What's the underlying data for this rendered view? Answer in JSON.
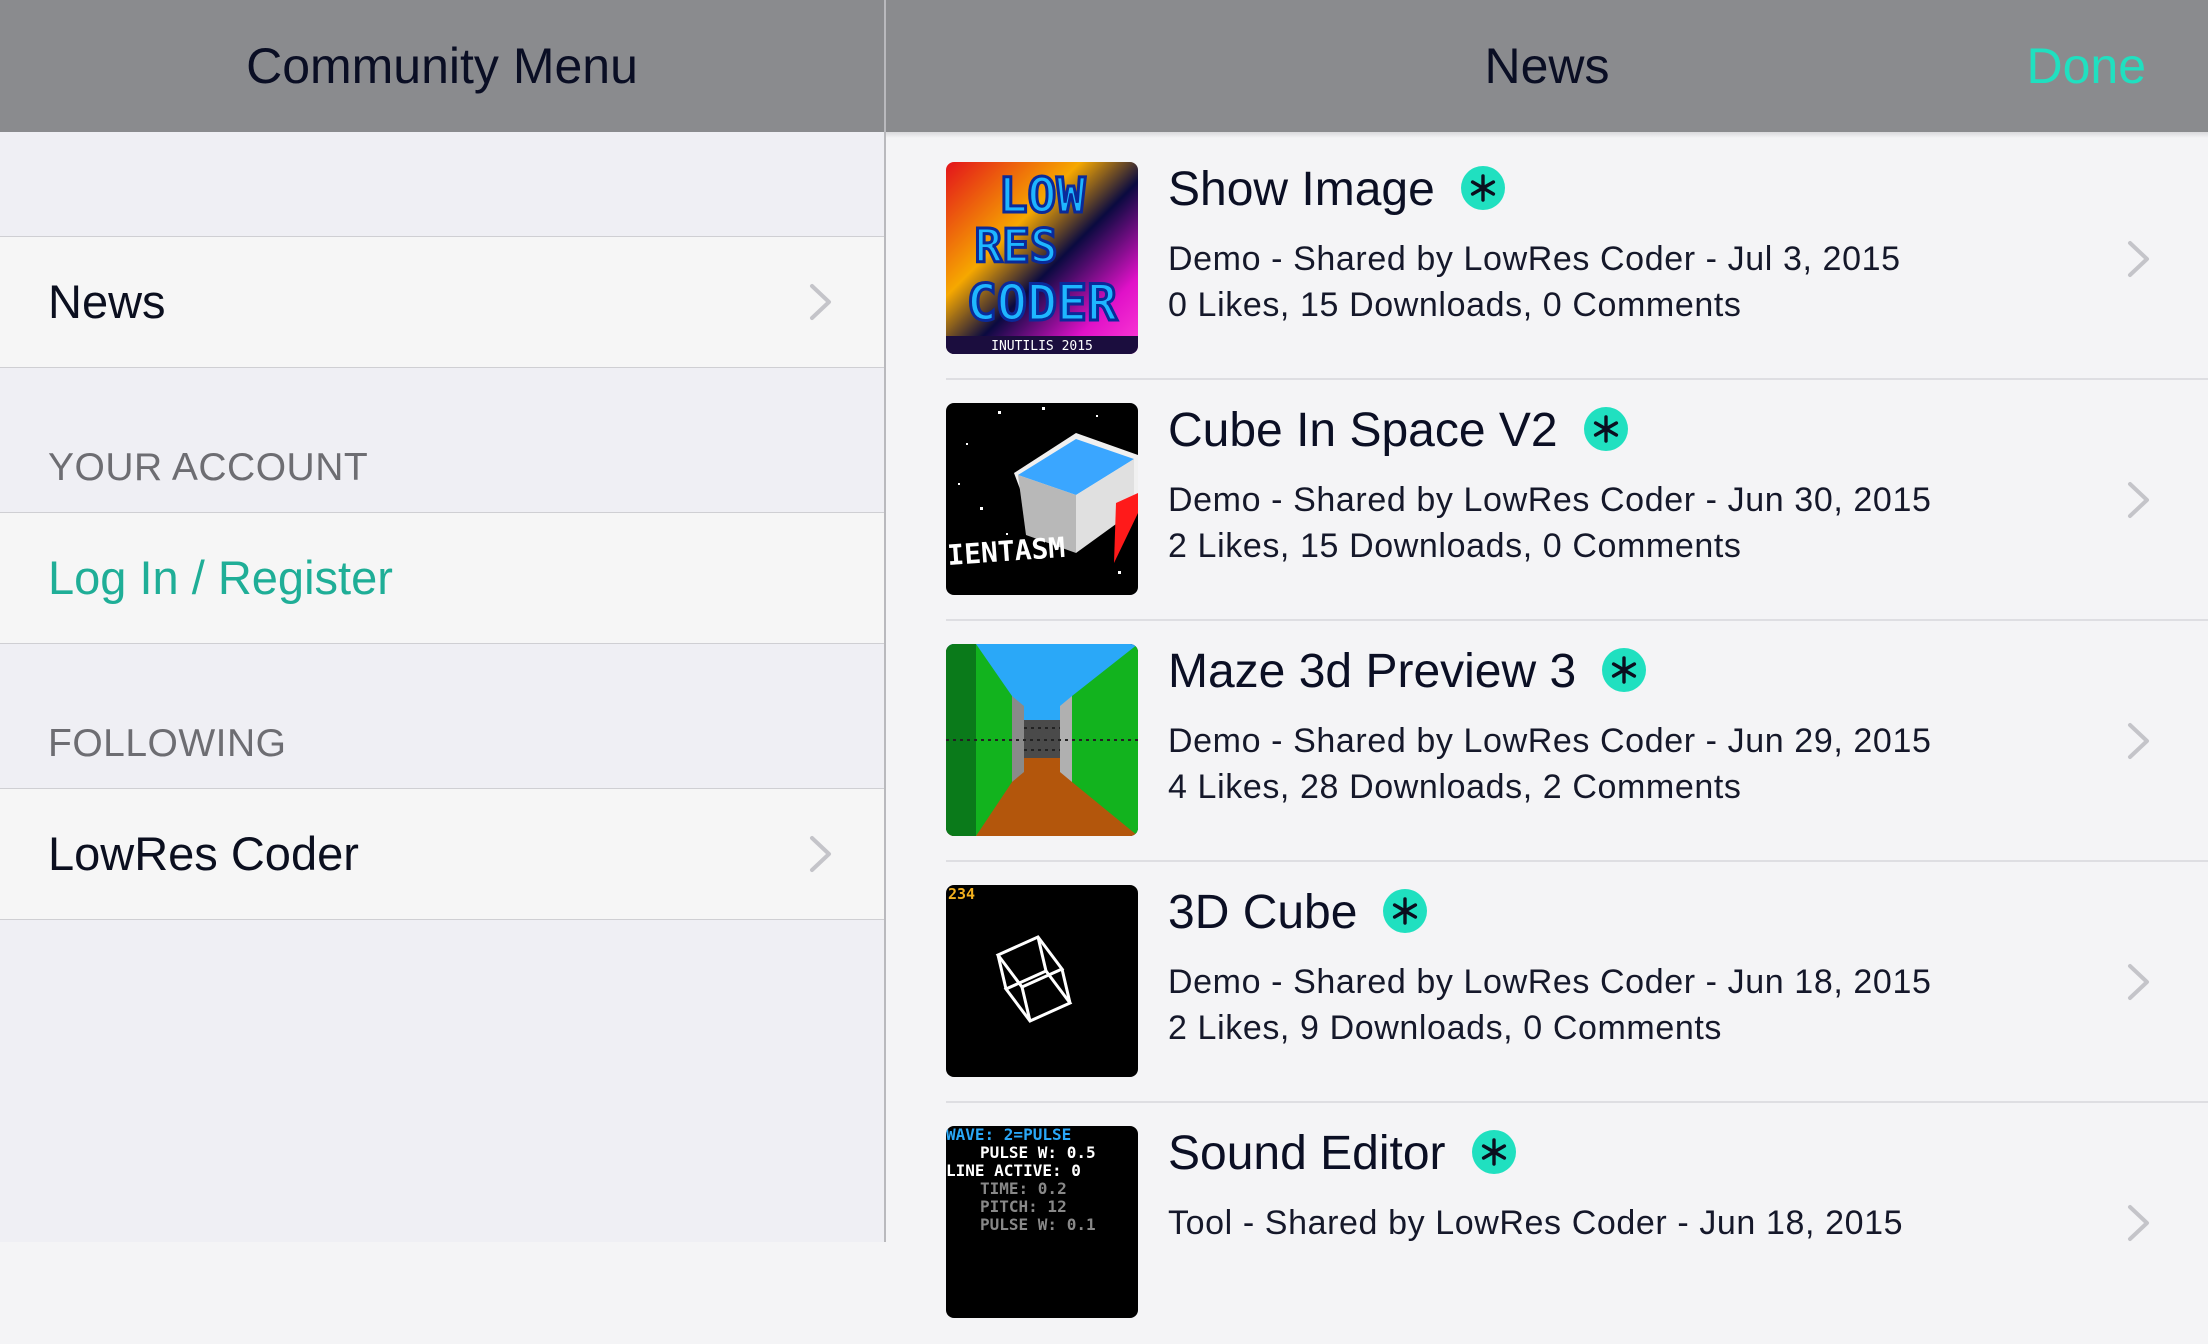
{
  "menu": {
    "title": "Community Menu",
    "news_label": "News",
    "account_header": "YOUR ACCOUNT",
    "login_label": "Log In / Register",
    "following_header": "FOLLOWING",
    "following_items": [
      "LowRes Coder"
    ]
  },
  "news": {
    "title": "News",
    "done_label": "Done",
    "accent_color": "#20e0c0",
    "items": [
      {
        "title": "Show Image",
        "subtitle": "Demo - Shared by LowRes Coder - Jul 3, 2015",
        "stats": "0 Likes, 15 Downloads, 0 Comments",
        "thumb_icon": "lowres-coder-logo-thumbnail"
      },
      {
        "title": "Cube In Space V2",
        "subtitle": "Demo - Shared by LowRes Coder - Jun 30, 2015",
        "stats": "2 Likes, 15 Downloads, 0 Comments",
        "thumb_icon": "cube-in-space-thumbnail"
      },
      {
        "title": "Maze 3d Preview 3",
        "subtitle": "Demo - Shared by LowRes Coder - Jun 29, 2015",
        "stats": "4 Likes, 28 Downloads, 2 Comments",
        "thumb_icon": "maze-corridor-thumbnail"
      },
      {
        "title": "3D Cube",
        "subtitle": "Demo - Shared by LowRes Coder - Jun 18, 2015",
        "stats": "2 Likes, 9 Downloads, 0 Comments",
        "thumb_icon": "wireframe-cube-thumbnail"
      },
      {
        "title": "Sound Editor",
        "subtitle": "Tool - Shared by LowRes Coder - Jun 18, 2015",
        "stats": "",
        "thumb_icon": "sound-editor-thumbnail"
      }
    ],
    "thumb_texts": {
      "logo_line1": "LOW",
      "logo_line2": "RES",
      "logo_line3": "CODER",
      "logo_footer": "INUTILIS 2015",
      "cube_caption": "IENTASM",
      "cube_counter": "234",
      "sound_lines": [
        "WAVE: 2=PULSE",
        "PULSE W: 0.5",
        "LINE ACTIVE: 0",
        "TIME: 0.2",
        "PITCH: 12",
        "PULSE W: 0.1"
      ]
    }
  }
}
